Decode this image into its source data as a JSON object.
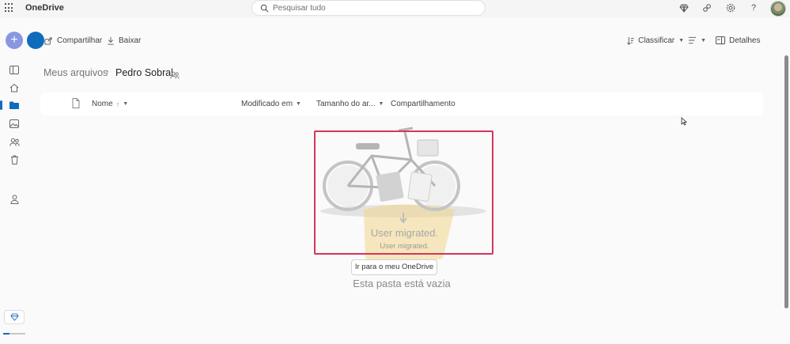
{
  "app": {
    "title": "OneDrive"
  },
  "search": {
    "placeholder": "Pesquisar tudo"
  },
  "commands": {
    "share_label": "Compartilhar",
    "download_label": "Baixar",
    "sort_label": "Classificar",
    "details_label": "Detalhes"
  },
  "breadcrumb": {
    "parent": "Meus arquivos",
    "separator": "›",
    "current": "Pedro Sobral"
  },
  "columns": {
    "name": "Nome",
    "name_sort": "↑",
    "modified": "Modificado em",
    "size": "Tamanho do ar...",
    "sharing": "Compartilhamento"
  },
  "empty_state": {
    "migrated_title": "User migrated.",
    "migrated_subtitle": "User migrated.",
    "go_button": "Ir para o meu OneDrive",
    "empty_text": "Esta pasta está vazia"
  },
  "icons": {
    "top_right": [
      "premium-icon",
      "people-icon",
      "settings-icon",
      "help-icon"
    ],
    "rail": [
      "menu-icon",
      "home-icon",
      "folder-icon",
      "photos-icon",
      "shared-icon",
      "recycle-bin-icon",
      "person-icon"
    ]
  },
  "colors": {
    "accent": "#0f6cbd",
    "new_button": "#8a96e0",
    "highlight_border": "#d6345b"
  }
}
